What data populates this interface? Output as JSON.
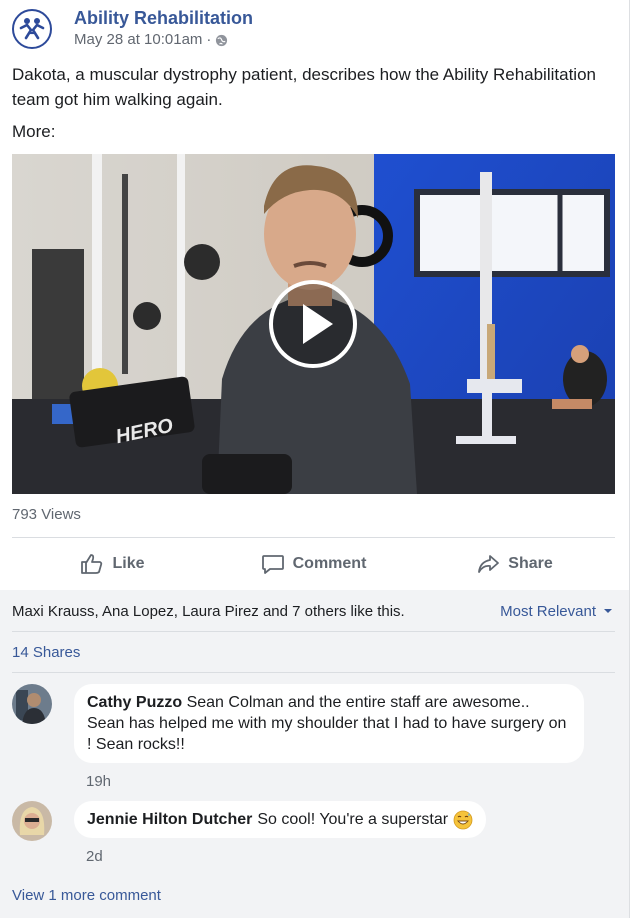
{
  "post": {
    "page_name": "Ability Rehabilitation",
    "time": "May 28 at 10:01am",
    "separator": "·",
    "privacy_icon": "globe-icon",
    "text": "Dakota, a muscular dystrophy patient, describes how the Ability Rehabilitation team got him walking again.",
    "more_label": "More:",
    "video": {
      "play_icon": "play-icon",
      "equipment_label": "HERO"
    },
    "views": "793 Views"
  },
  "actions": {
    "like": "Like",
    "comment": "Comment",
    "share": "Share"
  },
  "engagement": {
    "likes_text": "Maxi Krauss, Ana Lopez, Laura Pirez and 7 others like this.",
    "sort_label": "Most Relevant",
    "shares": "14 Shares"
  },
  "comments": [
    {
      "author": "Cathy Puzzo",
      "text": "Sean Colman and the entire staff are awesome.. Sean has helped me with my shoulder that I had to have surgery on ! Sean rocks!!",
      "time": "19h"
    },
    {
      "author": "Jennie Hilton Dutcher",
      "text": "So cool! You're a superstar",
      "emoji": "grinning-sweat-emoji",
      "time": "2d"
    }
  ],
  "view_more": "View 1 more comment",
  "colors": {
    "link": "#385898",
    "muted": "#606770",
    "accent_blue": "#2146c7"
  }
}
